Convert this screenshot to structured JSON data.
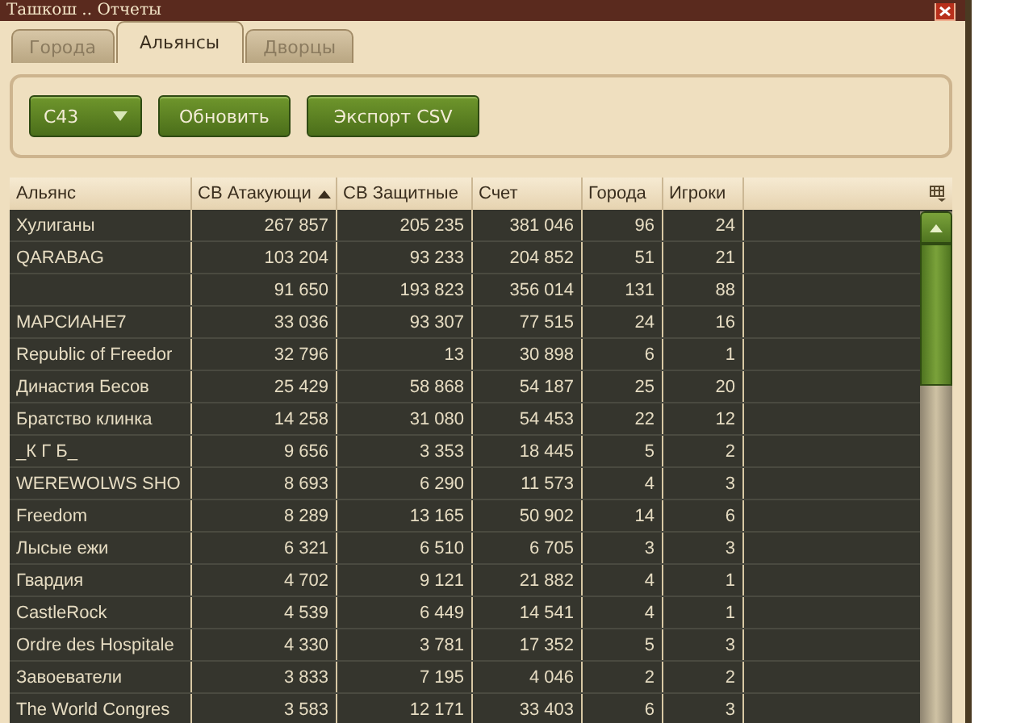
{
  "window": {
    "title": "Ташкош .. Отчеты"
  },
  "tabs": [
    {
      "label": "Города",
      "selected": false
    },
    {
      "label": "Альянсы",
      "selected": true
    },
    {
      "label": "Дворцы",
      "selected": false
    }
  ],
  "toolbar": {
    "dropdown": {
      "value": "C43"
    },
    "buttons": [
      "Обновить",
      "Экспорт CSV"
    ]
  },
  "table": {
    "columns": [
      {
        "label": "Альянс",
        "sorted": false
      },
      {
        "label": "СВ Атакующи",
        "sorted": true
      },
      {
        "label": "СВ Защитные",
        "sorted": false
      },
      {
        "label": "Счет",
        "sorted": false
      },
      {
        "label": "Города",
        "sorted": false
      },
      {
        "label": "Игроки",
        "sorted": false
      }
    ],
    "rows": [
      [
        "Хулиганы",
        "267 857",
        "205 235",
        "381 046",
        "96",
        "24"
      ],
      [
        "QARABAG",
        "103 204",
        "93 233",
        "204 852",
        "51",
        "21"
      ],
      [
        "",
        "91 650",
        "193 823",
        "356 014",
        "131",
        "88"
      ],
      [
        "МАРСИАНЕ7",
        "33 036",
        "93 307",
        "77 515",
        "24",
        "16"
      ],
      [
        "Republic of Freedor",
        "32 796",
        "13",
        "30 898",
        "6",
        "1"
      ],
      [
        "Династия Бесов",
        "25 429",
        "58 868",
        "54 187",
        "25",
        "20"
      ],
      [
        "Братство клинка",
        "14 258",
        "31 080",
        "54 453",
        "22",
        "12"
      ],
      [
        "_К Г Б_",
        "9 656",
        "3 353",
        "18 445",
        "5",
        "2"
      ],
      [
        "WEREWOLWS SHO",
        "8 693",
        "6 290",
        "11 573",
        "4",
        "3"
      ],
      [
        "Freedom",
        "8 289",
        "13 165",
        "50 902",
        "14",
        "6"
      ],
      [
        "Лысые ежи",
        "6 321",
        "6 510",
        "6 705",
        "3",
        "3"
      ],
      [
        "Гвардия",
        "4 702",
        "9 121",
        "21 882",
        "4",
        "1"
      ],
      [
        "CastleRock",
        "4 539",
        "6 449",
        "14 541",
        "4",
        "1"
      ],
      [
        "Ordre des Hospitale",
        "4 330",
        "3 781",
        "17 352",
        "5",
        "3"
      ],
      [
        "Завоеватели",
        "3 833",
        "7 195",
        "4 046",
        "2",
        "2"
      ],
      [
        "The World Congres",
        "3 583",
        "12 171",
        "33 403",
        "6",
        "3"
      ]
    ]
  }
}
